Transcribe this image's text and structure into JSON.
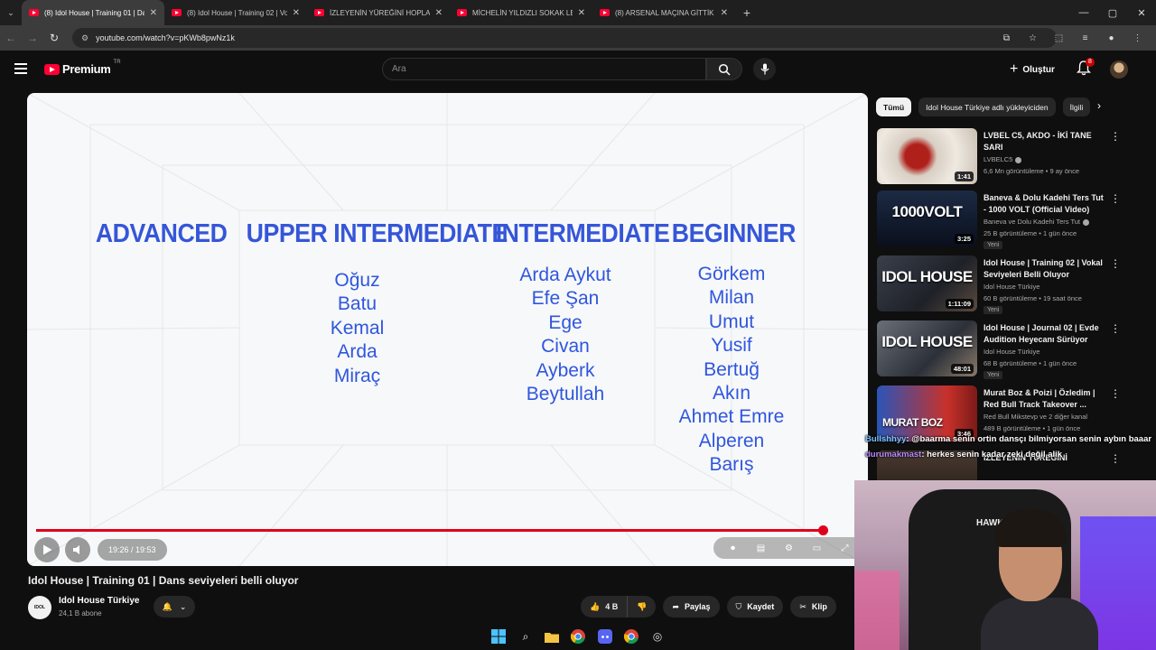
{
  "browser": {
    "tabs": [
      {
        "title": "(8) Idol House | Training 01 | Da",
        "active": true
      },
      {
        "title": "(8) Idol House | Training 02 | Vo",
        "active": false
      },
      {
        "title": "İZLEYENİN YÜREĞİNİ HOPLATA",
        "active": false
      },
      {
        "title": "MİCHELİN YILDIZLI SOKAK LEZZ",
        "active": false
      },
      {
        "title": "(8) ARSENAL MAÇINA GİTTİK | F",
        "active": false
      }
    ],
    "url": "youtube.com/watch?v=pKWb8pwNz1k"
  },
  "youtube": {
    "logo_text": "Premium",
    "logo_region": "TR",
    "search_placeholder": "Ara",
    "create_label": "Oluştur",
    "notification_count": "8"
  },
  "video": {
    "levels": [
      {
        "heading": "ADVANCED",
        "names": []
      },
      {
        "heading": "UPPER INTERMEDIATE",
        "names": [
          "Oğuz",
          "Batu",
          "Kemal",
          "Arda",
          "Miraç"
        ]
      },
      {
        "heading": "INTERMEDIATE",
        "names": [
          "Arda Aykut",
          "Efe Şan",
          "Ege",
          "Civan",
          "Ayberk",
          "Beytullah"
        ]
      },
      {
        "heading": "BEGINNER",
        "names": [
          "Görkem",
          "Milan",
          "Umut",
          "Yusif",
          "Bertuğ",
          "Akın",
          "Ahmet Emre",
          "Alperen",
          "Barış"
        ]
      }
    ],
    "time": "19:26 / 19:53",
    "progress": 0.977,
    "title": "Idol House | Training 01 | Dans seviyeleri belli oluyor",
    "channel": "Idol House Türkiye",
    "subscribers": "24,1 B abone",
    "likes": "4 B",
    "share_label": "Paylaş",
    "save_label": "Kaydet",
    "clip_label": "Klip"
  },
  "sidebar": {
    "chips": [
      "Tümü",
      "Idol House Türkiye adlı yükleyiciden",
      "İlgili"
    ],
    "recommendations": [
      {
        "title": "LVBEL C5, AKDO - İKİ TANE SARI",
        "channel": "LVBELC5",
        "meta": "6,6 Mn görüntüleme • 9 ay önce",
        "duration": "1:41",
        "new": "",
        "thumb_text": ""
      },
      {
        "title": "Baneva & Dolu Kadehi Ters Tut - 1000 VOLT (Official Video)",
        "channel": "Baneva ve Dolu Kadehi Ters Tut",
        "meta": "25 B görüntüleme • 1 gün önce",
        "duration": "3:25",
        "new": "Yeni",
        "thumb_text": "1000VOLT"
      },
      {
        "title": "Idol House | Training 02 | Vokal Seviyeleri Belli Oluyor",
        "channel": "Idol House Türkiye",
        "meta": "60 B görüntüleme • 19 saat önce",
        "duration": "1:11:09",
        "new": "Yeni",
        "thumb_text": "IDOL HOUSE"
      },
      {
        "title": "Idol House | Journal 02 | Evde Audition Heyecanı Sürüyor",
        "channel": "Idol House Türkiye",
        "meta": "68 B görüntüleme • 1 gün önce",
        "duration": "48:01",
        "new": "Yeni",
        "thumb_text": "IDOL HOUSE"
      },
      {
        "title": "Murat Boz & Poizi | Özledim | Red Bull Track Takeover ...",
        "channel": "Red Bull Mikstevp ve 2 diğer kanal",
        "meta": "489 B görüntüleme • 1 gün önce",
        "duration": "3:46",
        "new": "",
        "thumb_text": "MURAT BOZ"
      },
      {
        "title": "İZLEYENİN YÜREĞİNİ",
        "channel": "",
        "meta": "",
        "duration": "",
        "new": "",
        "thumb_text": ""
      }
    ]
  },
  "chat": [
    {
      "user": "Bullshhyy",
      "text": ": @baarma senin ortin dansçı bilmiyorsan senin aybın baaar"
    },
    {
      "user": "durumakmast",
      "text": ": herkes senin kadar zeki değil alik"
    }
  ],
  "webcam": {
    "brand": "HAWK"
  }
}
